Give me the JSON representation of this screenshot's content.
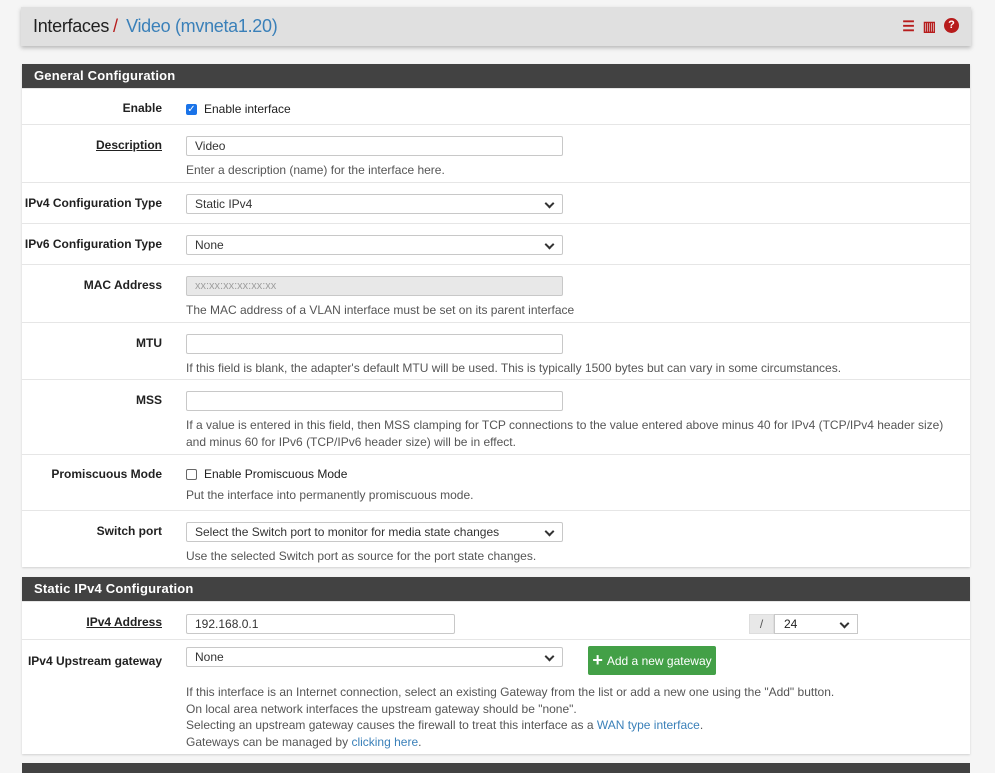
{
  "breadcrumb": {
    "section": "Interfaces",
    "separator": "/",
    "page": "Video (mvneta1.20)"
  },
  "header_icons": [
    "sliders-icon",
    "bar-chart-icon",
    "help-icon"
  ],
  "general": {
    "title": "General Configuration",
    "enable": {
      "label": "Enable",
      "checkbox": "Enable interface",
      "checked": true
    },
    "description": {
      "label": "Description",
      "value": "Video",
      "help": "Enter a description (name) for the interface here."
    },
    "ipv4type": {
      "label": "IPv4 Configuration Type",
      "value": "Static IPv4"
    },
    "ipv6type": {
      "label": "IPv6 Configuration Type",
      "value": "None"
    },
    "mac": {
      "label": "MAC Address",
      "placeholder": "xx:xx:xx:xx:xx:xx",
      "help": "The MAC address of a VLAN interface must be set on its parent interface"
    },
    "mtu": {
      "label": "MTU",
      "value": "",
      "help": "If this field is blank, the adapter's default MTU will be used. This is typically 1500 bytes but can vary in some circumstances."
    },
    "mss": {
      "label": "MSS",
      "value": "",
      "help": "If a value is entered in this field, then MSS clamping for TCP connections to the value entered above minus 40 for IPv4 (TCP/IPv4 header size) and minus 60 for IPv6 (TCP/IPv6 header size) will be in effect."
    },
    "promisc": {
      "label": "Promiscuous Mode",
      "checkbox": "Enable Promiscuous Mode",
      "checked": false,
      "help": "Put the interface into permanently promiscuous mode."
    },
    "switchport": {
      "label": "Switch port",
      "value": "Select the Switch port to monitor for media state changes",
      "help": "Use the selected Switch port as source for the port state changes."
    }
  },
  "static": {
    "title": "Static IPv4 Configuration",
    "address": {
      "label": "IPv4 Address",
      "value": "192.168.0.1",
      "slash": "/",
      "cidr": "24"
    },
    "gateway": {
      "label": "IPv4 Upstream gateway",
      "value": "None",
      "add_button": "Add a new gateway",
      "help1": "If this interface is an Internet connection, select an existing Gateway from the list or add a new one using the \"Add\" button.",
      "help2": "On local area network interfaces the upstream gateway should be \"none\".",
      "help3_pre": "Selecting an upstream gateway causes the firewall to treat this interface as a ",
      "help3_link": "WAN type interface",
      "help3_post": ".",
      "help4_pre": "Gateways can be managed by ",
      "help4_link": "clicking here",
      "help4_post": "."
    }
  }
}
